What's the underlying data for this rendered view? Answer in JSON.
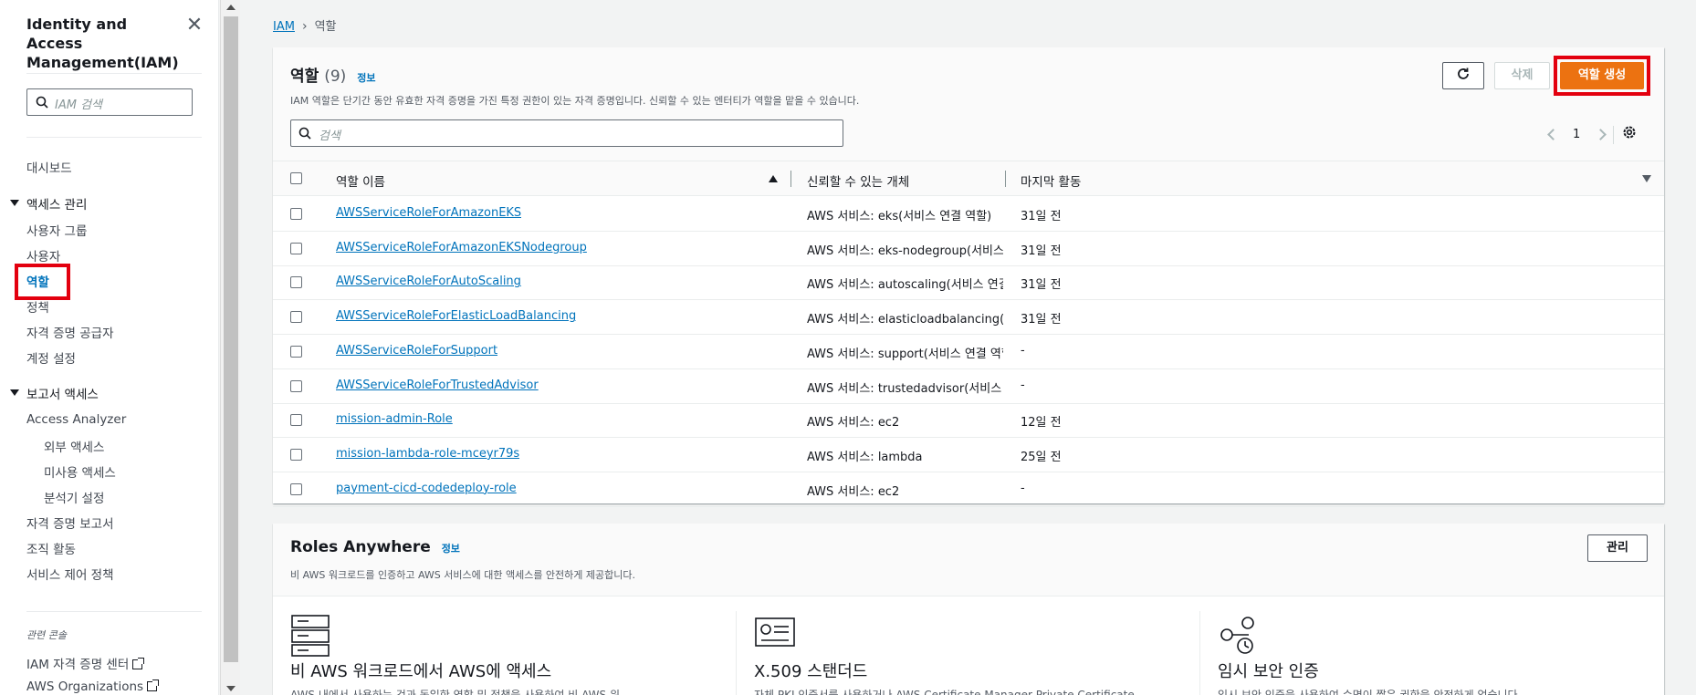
{
  "sidebar": {
    "title": "Identity and Access Management(IAM)",
    "search_placeholder": "IAM 검색",
    "dashboard": "대시보드",
    "access_mgmt": "액세스 관리",
    "user_groups": "사용자 그룹",
    "users": "사용자",
    "roles": "역할",
    "policies": "정책",
    "identity_providers": "자격 증명 공급자",
    "account_settings": "계정 설정",
    "reports": "보고서 액세스",
    "access_analyzer": "Access Analyzer",
    "external_access": "외부 액세스",
    "unused_access": "미사용 액세스",
    "analyzer_settings": "분석기 설정",
    "credential_report": "자격 증명 보고서",
    "org_activity": "조직 활동",
    "scp": "서비스 제어 정책",
    "related_consoles": "관련 콘솔",
    "iam_identity_center": "IAM 자격 증명 센터",
    "aws_organizations": "AWS Organizations"
  },
  "breadcrumb": {
    "root": "IAM",
    "current": "역할"
  },
  "roles_panel": {
    "title": "역할",
    "count": "(9)",
    "info": "정보",
    "description": "IAM 역할은 단기간 동안 유효한 자격 증명을 가진 특정 권한이 있는 자격 증명입니다. 신뢰할 수 있는 엔터티가 역할을 맡을 수 있습니다.",
    "delete_label": "삭제",
    "create_label": "역할 생성",
    "search_placeholder": "검색",
    "page": "1",
    "columns": {
      "name": "역할 이름",
      "trusted": "신뢰할 수 있는 개체",
      "last": "마지막 활동"
    },
    "rows": [
      {
        "name": "AWSServiceRoleForAmazonEKS",
        "trust_prefix": "AWS 서비스: eks",
        "trust_link": "(서비스 연결 역할)",
        "last": "31일 전"
      },
      {
        "name": "AWSServiceRoleForAmazonEKSNodegroup",
        "trust_prefix": "AWS 서비스: eks-nodegroup",
        "trust_link": "(서비스 연결 역할)",
        "last": "31일 전"
      },
      {
        "name": "AWSServiceRoleForAutoScaling",
        "trust_prefix": "AWS 서비스: autoscaling",
        "trust_link": "(서비스 연결 역할)",
        "last": "31일 전"
      },
      {
        "name": "AWSServiceRoleForElasticLoadBalancing",
        "trust_prefix": "AWS 서비스: elasticloadbalancing",
        "trust_link": "(서비스 연결 역할)",
        "last": "31일 전"
      },
      {
        "name": "AWSServiceRoleForSupport",
        "trust_prefix": "AWS 서비스: support",
        "trust_link": "(서비스 연결 역할)",
        "last": "-"
      },
      {
        "name": "AWSServiceRoleForTrustedAdvisor",
        "trust_prefix": "AWS 서비스: trustedadvisor",
        "trust_link": "(서비스 연결 역할)",
        "last": "-"
      },
      {
        "name": "mission-admin-Role",
        "trust_prefix": "AWS 서비스: ec2",
        "trust_link": "",
        "last": "12일 전"
      },
      {
        "name": "mission-lambda-role-mceyr79s",
        "trust_prefix": "AWS 서비스: lambda",
        "trust_link": "",
        "last": "25일 전"
      },
      {
        "name": "payment-cicd-codedeploy-role",
        "trust_prefix": "AWS 서비스: ec2",
        "trust_link": "",
        "last": "-"
      }
    ]
  },
  "roles_anywhere": {
    "title": "Roles Anywhere",
    "info": "정보",
    "description": "비 AWS 워크로드를 인증하고 AWS 서비스에 대한 액세스를 안전하게 제공합니다.",
    "manage_label": "관리",
    "cards": [
      {
        "heading": "비 AWS 워크로드에서 AWS에 액세스",
        "text": "AWS 내에서 사용하는 것과 동일한 역할 및 정책을 사용하여 비 AWS 워"
      },
      {
        "heading": "X.509 스탠더드",
        "text": "자체 PKI 인증서를 사용하거나 AWS Certificate Manager Private Certificate"
      },
      {
        "heading": "임시 보안 인증",
        "text": "임시 보안 인증을 사용하여 수명이 짧은 권한을 안전하게 얻습니다."
      }
    ]
  }
}
